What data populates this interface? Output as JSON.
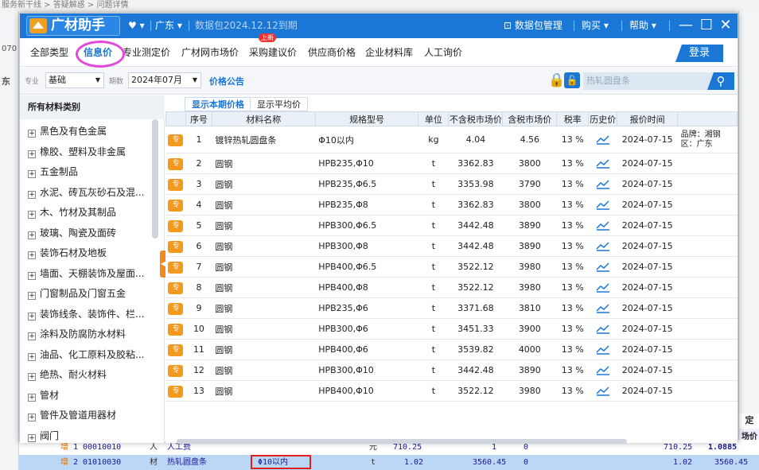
{
  "breadcrumb": "服务新干线 > 答疑解惑 > 问题详情",
  "left_edge_hints": [
    "070",
    "东"
  ],
  "right_edge_hints": [
    "定",
    "场价"
  ],
  "window": {
    "app_name": "广材助手",
    "region": "广东",
    "package_status": "数据包2024.12.12到期",
    "toolbar": {
      "data_package": "数据包管理",
      "buy": "购买",
      "help": "帮助"
    },
    "tabs": [
      {
        "label": "全部类型"
      },
      {
        "label": "信息价",
        "active": true
      },
      {
        "label": "专业测定价"
      },
      {
        "label": "广材网市场价"
      },
      {
        "label": "采购建议价",
        "badge": "上新"
      },
      {
        "label": "供应商价格"
      },
      {
        "label": "企业材料库"
      },
      {
        "label": "人工询价"
      }
    ],
    "login_label": "登录",
    "filters": {
      "major_label": "专业",
      "major_value": "基础",
      "period_label": "期数",
      "period_value": "2024年07月",
      "announcement": "价格公告",
      "search_placeholder": "热轧圆盘条"
    },
    "sidebar": {
      "title": "所有材料类别",
      "items": [
        "黑色及有色金属",
        "橡胶、塑料及非金属",
        "五金制品",
        "水泥、砖瓦灰砂石及混...",
        "木、竹材及其制品",
        "玻璃、陶瓷及面砖",
        "装饰石材及地板",
        "墙面、天棚装饰及屋面...",
        "门窗制品及门窗五金",
        "装饰线条、装饰件、栏...",
        "涂料及防腐防水材料",
        "油品、化工原料及胶粘...",
        "绝热、耐火材料",
        "管材",
        "管件及管道用器材",
        "阀门"
      ]
    },
    "subtabs": [
      "显示本期价格",
      "显示平均价"
    ],
    "table": {
      "headers": [
        "序号",
        "材料名称",
        "规格型号",
        "单位",
        "不含税市场价",
        "含税市场价",
        "税率",
        "历史价",
        "报价时间",
        ""
      ],
      "tag": "专",
      "rows": [
        {
          "no": "1",
          "name": "镀锌热轧圆盘条",
          "spec": "Φ10以内",
          "unit": "kg",
          "ex_tax": "4.04",
          "in_tax": "4.56",
          "rate": "13 %",
          "date": "2024-07-15",
          "note": "品牌：湘钢  区：广东"
        },
        {
          "no": "2",
          "name": "圆钢",
          "spec": "HPB235,Φ10",
          "unit": "t",
          "ex_tax": "3362.83",
          "in_tax": "3800",
          "rate": "13 %",
          "date": "2024-07-15",
          "note": ""
        },
        {
          "no": "3",
          "name": "圆钢",
          "spec": "HPB235,Φ6.5",
          "unit": "t",
          "ex_tax": "3353.98",
          "in_tax": "3790",
          "rate": "13 %",
          "date": "2024-07-15",
          "note": ""
        },
        {
          "no": "4",
          "name": "圆钢",
          "spec": "HPB235,Φ8",
          "unit": "t",
          "ex_tax": "3362.83",
          "in_tax": "3800",
          "rate": "13 %",
          "date": "2024-07-15",
          "note": ""
        },
        {
          "no": "5",
          "name": "圆钢",
          "spec": "HPB300,Φ6.5",
          "unit": "t",
          "ex_tax": "3442.48",
          "in_tax": "3890",
          "rate": "13 %",
          "date": "2024-07-15",
          "note": ""
        },
        {
          "no": "6",
          "name": "圆钢",
          "spec": "HPB300,Φ8",
          "unit": "t",
          "ex_tax": "3442.48",
          "in_tax": "3890",
          "rate": "13 %",
          "date": "2024-07-15",
          "note": ""
        },
        {
          "no": "7",
          "name": "圆钢",
          "spec": "HPB400,Φ6.5",
          "unit": "t",
          "ex_tax": "3522.12",
          "in_tax": "3980",
          "rate": "13 %",
          "date": "2024-07-15",
          "note": ""
        },
        {
          "no": "8",
          "name": "圆钢",
          "spec": "HPB400,Φ8",
          "unit": "t",
          "ex_tax": "3522.12",
          "in_tax": "3980",
          "rate": "13 %",
          "date": "2024-07-15",
          "note": ""
        },
        {
          "no": "9",
          "name": "圆钢",
          "spec": "HPB235,Φ6",
          "unit": "t",
          "ex_tax": "3371.68",
          "in_tax": "3810",
          "rate": "13 %",
          "date": "2024-07-15",
          "note": ""
        },
        {
          "no": "10",
          "name": "圆钢",
          "spec": "HPB300,Φ6",
          "unit": "t",
          "ex_tax": "3451.33",
          "in_tax": "3900",
          "rate": "13 %",
          "date": "2024-07-15",
          "note": ""
        },
        {
          "no": "11",
          "name": "圆钢",
          "spec": "HPB400,Φ6",
          "unit": "t",
          "ex_tax": "3539.82",
          "in_tax": "4000",
          "rate": "13 %",
          "date": "2024-07-15",
          "note": ""
        },
        {
          "no": "12",
          "name": "圆钢",
          "spec": "HPB300,Φ10",
          "unit": "t",
          "ex_tax": "3442.48",
          "in_tax": "3890",
          "rate": "13 %",
          "date": "2024-07-15",
          "note": ""
        },
        {
          "no": "13",
          "name": "圆钢",
          "spec": "HPB400,Φ10",
          "unit": "t",
          "ex_tax": "3522.12",
          "in_tax": "3980",
          "rate": "13 %",
          "date": "2024-07-15",
          "note": ""
        }
      ]
    }
  },
  "background_rows": [
    {
      "action": "增",
      "no": "1",
      "code": "00010010",
      "type": "人",
      "name": "人工费",
      "spec": "",
      "unit": "元",
      "qty": "710.25",
      "v1": "1",
      "v2": "0",
      "v3": "710.25",
      "v4": "1.0885"
    },
    {
      "action": "增",
      "no": "2",
      "code": "01010030",
      "type": "材",
      "name": "热轧圆盘条",
      "spec": "Φ10以内",
      "unit": "t",
      "qty": "1.02",
      "v1": "3560.45",
      "v2": "0",
      "v3": "1.02",
      "v4": "3560.45"
    }
  ],
  "colors": {
    "accent": "#1b77d6",
    "tag": "#f39a1e",
    "annotation_circle": "#e24ad9",
    "annotation_box": "#e02020"
  }
}
